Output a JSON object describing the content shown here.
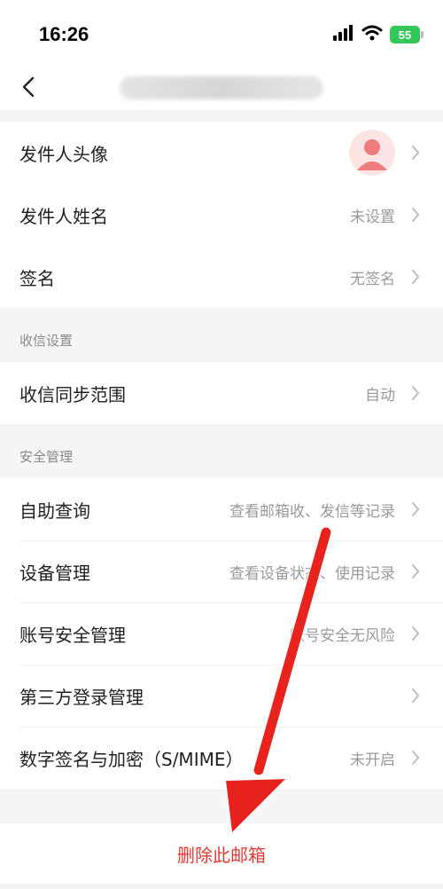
{
  "status_bar": {
    "time": "16:26",
    "battery": "55"
  },
  "nav": {
    "title": ""
  },
  "sender": {
    "avatar_label": "发件人头像",
    "name_label": "发件人姓名",
    "name_value": "未设置",
    "signature_label": "签名",
    "signature_value": "无签名"
  },
  "receive_settings": {
    "header": "收信设置",
    "sync_label": "收信同步范围",
    "sync_value": "自动"
  },
  "security": {
    "header": "安全管理",
    "items": [
      {
        "label": "自助查询",
        "value": "查看邮箱收、发信等记录"
      },
      {
        "label": "设备管理",
        "value": "查看设备状态、使用记录"
      },
      {
        "label": "账号安全管理",
        "value": "账号安全无风险"
      },
      {
        "label": "第三方登录管理",
        "value": ""
      },
      {
        "label": "数字签名与加密（S/MIME）",
        "value": "未开启"
      }
    ]
  },
  "delete_label": "删除此邮箱",
  "colors": {
    "accent_red": "#e53935",
    "battery_green": "#34c759",
    "background": "#f5f5f7"
  },
  "icons": [
    "signal-icon",
    "wifi-icon",
    "battery-icon",
    "back-icon",
    "chevron-right-icon",
    "avatar-icon"
  ]
}
